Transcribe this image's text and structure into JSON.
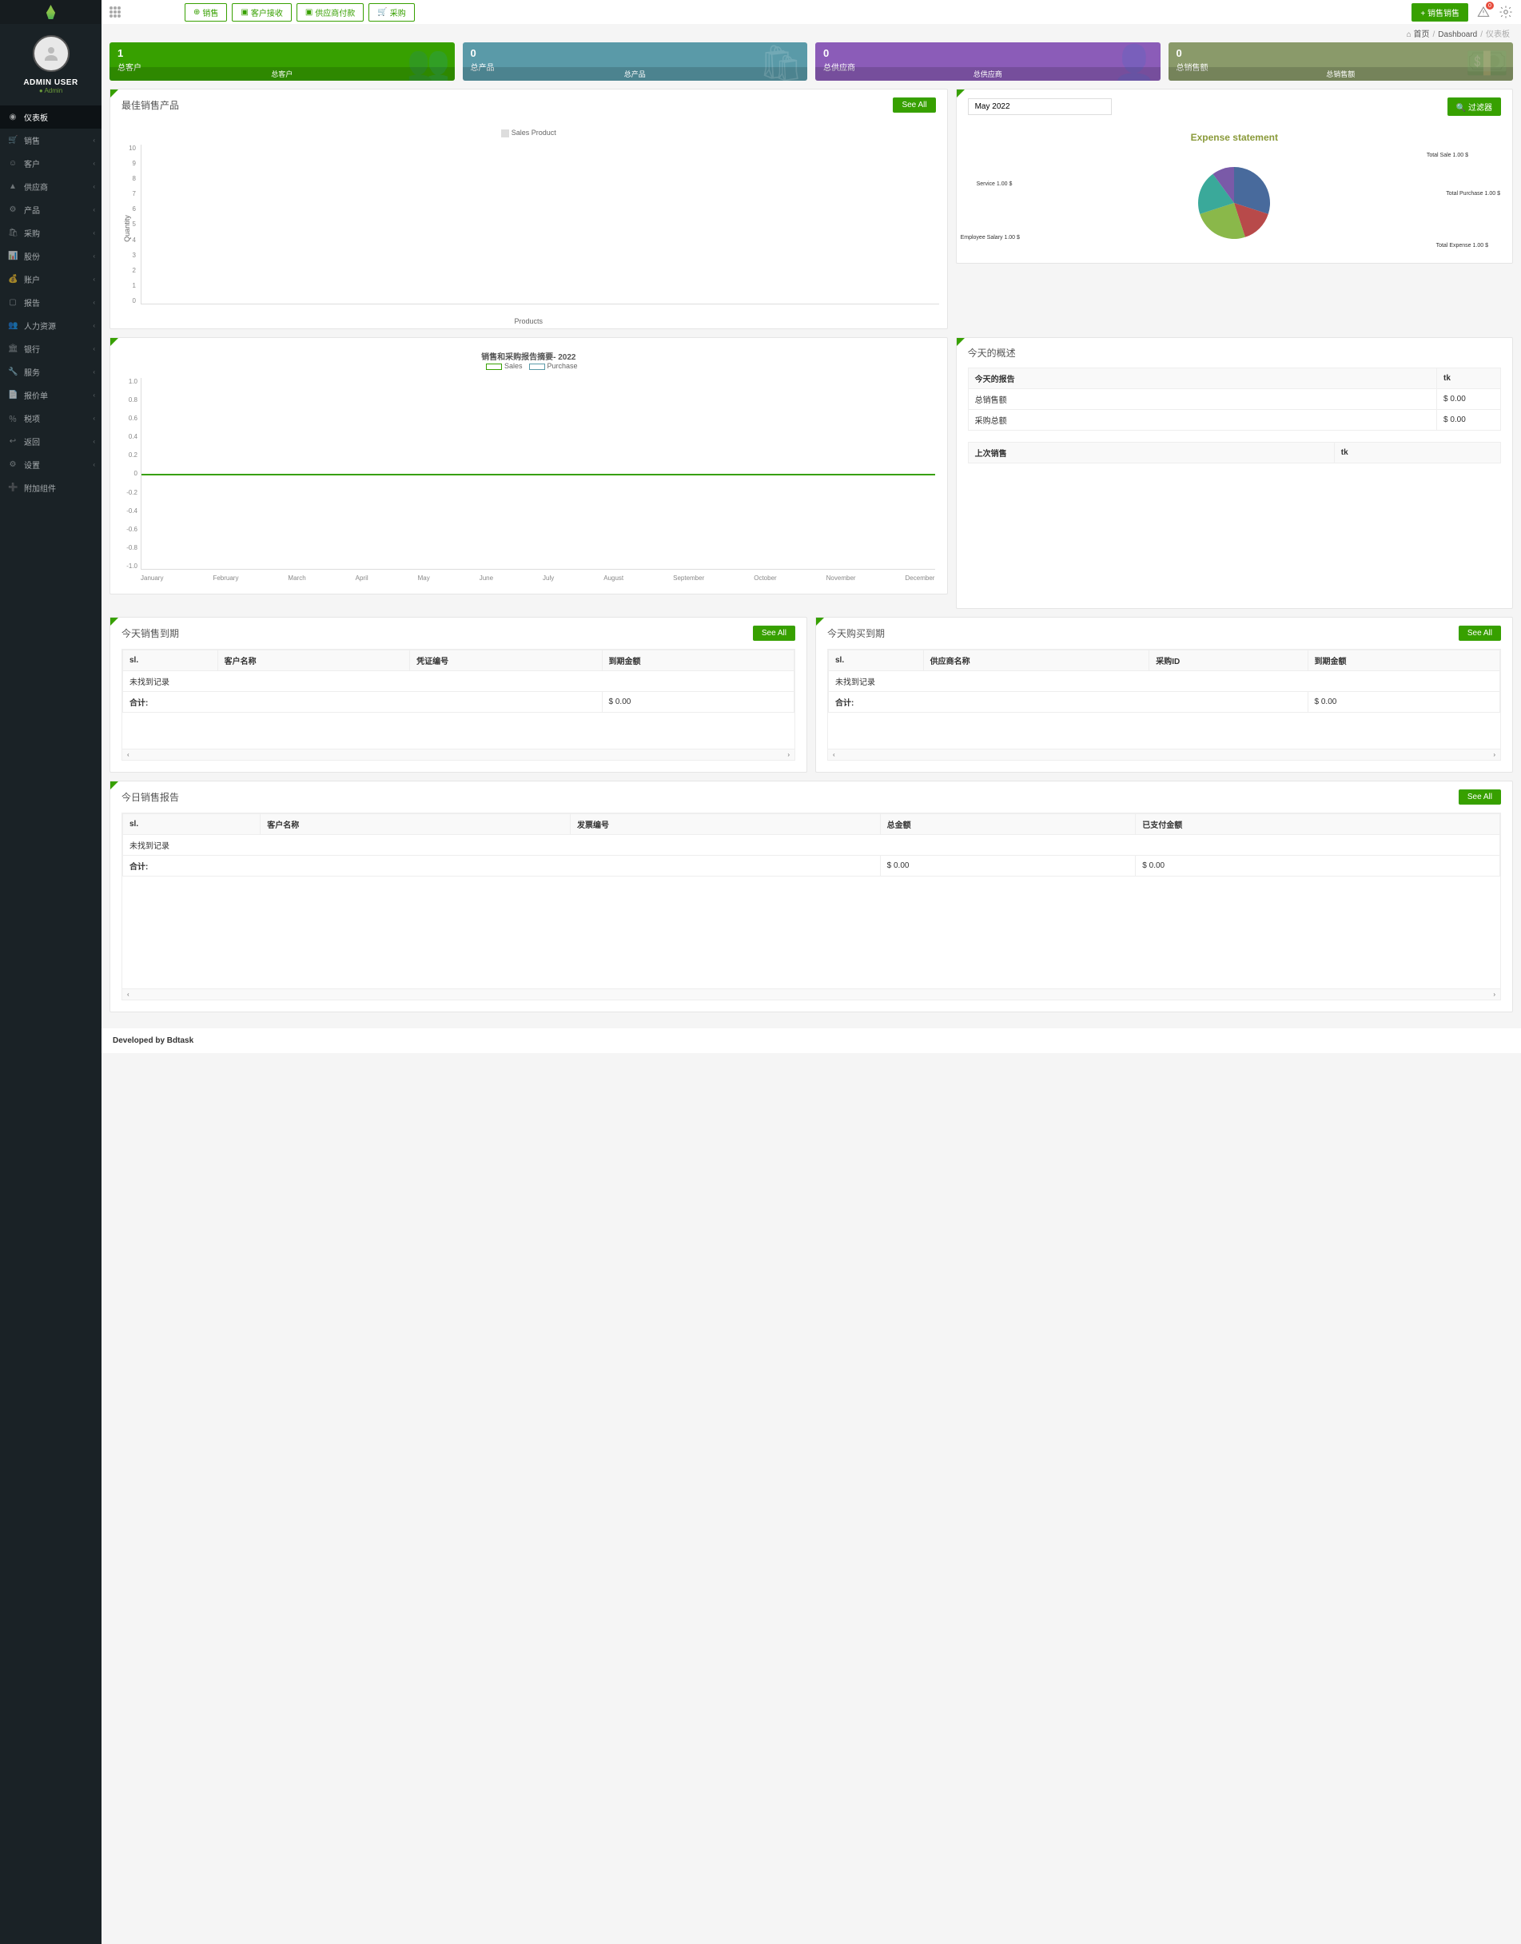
{
  "user": {
    "name": "ADMIN USER",
    "role": "Admin"
  },
  "nav": {
    "dashboard": "仪表板",
    "items": [
      "销售",
      "客户",
      "供应商",
      "产品",
      "采购",
      "股份",
      "账户",
      "报告",
      "人力资源",
      "银行",
      "服务",
      "报价单",
      "税项",
      "返回",
      "设置",
      "附加组件"
    ]
  },
  "topButtons": {
    "sales": "销售",
    "customerReceive": "客户接收",
    "supplierPay": "供应商付款",
    "purchase": "采购"
  },
  "topRight": {
    "salesBtn": "销售销售",
    "alertCount": "0"
  },
  "breadcrumb": {
    "home": "首页",
    "dashboard": "Dashboard",
    "current": "仪表板"
  },
  "stats": [
    {
      "num": "1",
      "label": "总客户",
      "footer": "总客户"
    },
    {
      "num": "0",
      "label": "总产品",
      "footer": "总产品"
    },
    {
      "num": "0",
      "label": "总供应商",
      "footer": "总供应商"
    },
    {
      "num": "0",
      "label": "总销售额",
      "footer": "总销售额"
    }
  ],
  "bestSales": {
    "title": "最佳销售产品",
    "seeAll": "See All",
    "legend": "Sales Product",
    "ylabel": "Quantity",
    "xlabel": "Products",
    "yticks": [
      "10",
      "9",
      "8",
      "7",
      "6",
      "5",
      "4",
      "3",
      "2",
      "1",
      "0"
    ]
  },
  "filter": {
    "month": "May 2022",
    "btn": "过滤器"
  },
  "expense": {
    "title": "Expense statement",
    "labels": [
      "Total Sale 1.00 $",
      "Total Purchase 1.00 $",
      "Total Expense 1.00 $",
      "Employee Salary 1.00 $",
      "Service  1.00 $"
    ]
  },
  "salesPurchase": {
    "title": "销售和采购报告摘要- 2022",
    "legend": {
      "sales": "Sales",
      "purchase": "Purchase"
    },
    "yticks": [
      "1.0",
      "0.8",
      "0.6",
      "0.4",
      "0.2",
      "0",
      "-0.2",
      "-0.4",
      "-0.6",
      "-0.8",
      "-1.0"
    ],
    "xticks": [
      "January",
      "February",
      "March",
      "April",
      "May",
      "June",
      "July",
      "August",
      "September",
      "October",
      "November",
      "December"
    ]
  },
  "overview": {
    "title": "今天的概述",
    "rows": [
      {
        "k": "今天的报告",
        "v": "tk"
      },
      {
        "k": "总销售额",
        "v": "$ 0.00"
      },
      {
        "k": "采购总额",
        "v": "$ 0.00"
      }
    ],
    "lastSale": {
      "k": "上次销售",
      "v": "tk"
    }
  },
  "dueSales": {
    "title": "今天销售到期",
    "seeAll": "See All",
    "cols": [
      "sl.",
      "客户名称",
      "凭证编号",
      "到期金额"
    ],
    "empty": "未找到记录",
    "totalLabel": "合计:",
    "total": "$ 0.00"
  },
  "duePurchase": {
    "title": "今天购买到期",
    "seeAll": "See All",
    "cols": [
      "sl.",
      "供应商名称",
      "采购ID",
      "到期金额"
    ],
    "empty": "未找到记录",
    "totalLabel": "合计:",
    "total": "$ 0.00"
  },
  "todayReport": {
    "title": "今日销售报告",
    "seeAll": "See All",
    "cols": [
      "sl.",
      "客户名称",
      "发票编号",
      "总金额",
      "已支付金额"
    ],
    "empty": "未找到记录",
    "totalLabel": "合计:",
    "total1": "$ 0.00",
    "total2": "$ 0.00"
  },
  "footer": "Developed by Bdtask",
  "chart_data": [
    {
      "type": "bar",
      "title": "Sales Product",
      "categories": [],
      "values": [],
      "xlabel": "Products",
      "ylabel": "Quantity",
      "ylim": [
        0,
        10
      ]
    },
    {
      "type": "pie",
      "title": "Expense statement",
      "series": [
        {
          "name": "Total Sale",
          "value": 1.0
        },
        {
          "name": "Total Purchase",
          "value": 1.0
        },
        {
          "name": "Total Expense",
          "value": 1.0
        },
        {
          "name": "Employee Salary",
          "value": 1.0
        },
        {
          "name": "Service",
          "value": 1.0
        }
      ]
    },
    {
      "type": "line",
      "title": "销售和采购报告摘要- 2022",
      "x": [
        "January",
        "February",
        "March",
        "April",
        "May",
        "June",
        "July",
        "August",
        "September",
        "October",
        "November",
        "December"
      ],
      "series": [
        {
          "name": "Sales",
          "values": [
            0,
            0,
            0,
            0,
            0,
            0,
            0,
            0,
            0,
            0,
            0,
            0
          ]
        },
        {
          "name": "Purchase",
          "values": [
            0,
            0,
            0,
            0,
            0,
            0,
            0,
            0,
            0,
            0,
            0,
            0
          ]
        }
      ],
      "ylim": [
        -1,
        1
      ]
    }
  ]
}
